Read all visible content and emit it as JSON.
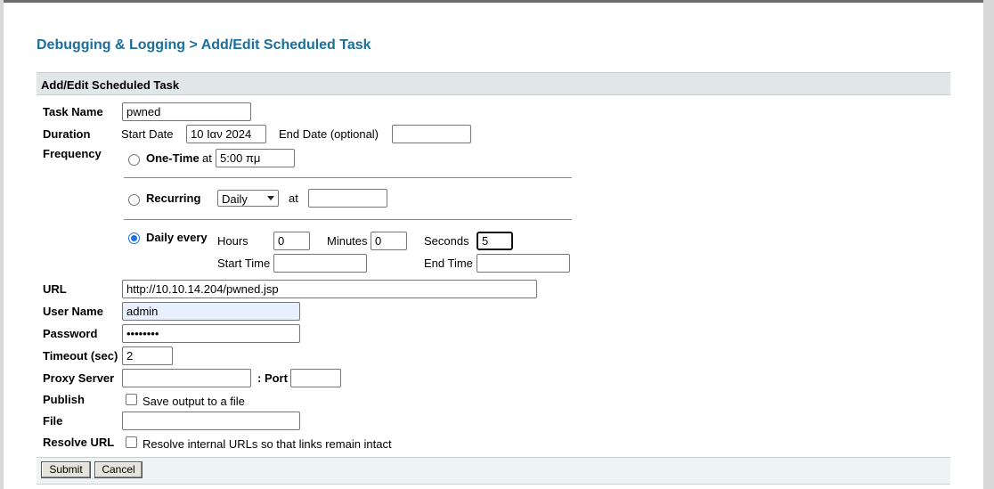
{
  "page": {
    "title": "Debugging & Logging > Add/Edit Scheduled Task",
    "panel_header": "Add/Edit Scheduled Task"
  },
  "form": {
    "task_name": {
      "label": "Task Name",
      "value": "pwned"
    },
    "duration": {
      "label": "Duration",
      "start_date_label": "Start Date",
      "start_date_value": "10 Ιαν 2024",
      "end_date_label": "End Date (optional)",
      "end_date_value": ""
    },
    "frequency": {
      "label": "Frequency",
      "one_time": {
        "label": "One-Time",
        "at_label": "at",
        "time_value": "5:00 πμ",
        "selected": false
      },
      "recurring": {
        "label": "Recurring",
        "select_value": "Daily",
        "at_label": "at",
        "time_value": "",
        "selected": false
      },
      "daily_every": {
        "label": "Daily every",
        "selected": true,
        "hours_label": "Hours",
        "hours_value": "0",
        "minutes_label": "Minutes",
        "minutes_value": "0",
        "seconds_label": "Seconds",
        "seconds_value": "5",
        "start_time_label": "Start Time",
        "start_time_value": "",
        "end_time_label": "End Time",
        "end_time_value": ""
      }
    },
    "url": {
      "label": "URL",
      "value": "http://10.10.14.204/pwned.jsp"
    },
    "user_name": {
      "label": "User Name",
      "value": "admin"
    },
    "password": {
      "label": "Password",
      "value": "••••••••"
    },
    "timeout": {
      "label": "Timeout (sec)",
      "value": "2"
    },
    "proxy": {
      "label": "Proxy Server",
      "value": "",
      "port_label": ": Port",
      "port_value": ""
    },
    "publish": {
      "label": "Publish",
      "checkbox_label": "Save output to a file",
      "checked": false
    },
    "file": {
      "label": "File",
      "value": ""
    },
    "resolve_url": {
      "label": "Resolve URL",
      "checkbox_label": "Resolve internal URLs so that links remain intact",
      "checked": false
    }
  },
  "buttons": {
    "submit": "Submit",
    "cancel": "Cancel"
  },
  "colors": {
    "title": "#1a6f9c",
    "header_bg": "#e1e6e6",
    "radio_selected": "#1a73e8"
  }
}
